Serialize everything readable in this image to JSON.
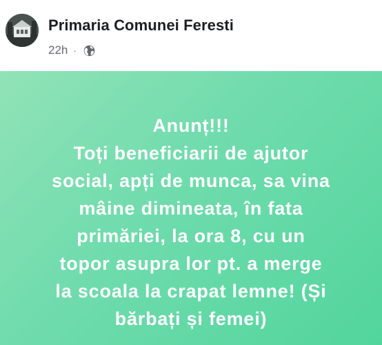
{
  "header": {
    "page_name": "Primaria Comunei Feresti",
    "time": "22h",
    "separator": "·",
    "audience_icon": "globe-icon"
  },
  "post": {
    "background_colors": [
      "#91e3b6",
      "#52d59d"
    ],
    "text_color": "#ffffff",
    "lines": [
      "Anunț!!!",
      "Toți beneficiarii de ajutor",
      "social, apți de munca, sa vina",
      "mâine dimineata, în fata",
      "primăriei, la ora 8, cu un",
      "topor asupra lor pt. a merge",
      "la scoala la crapat lemne! (Și",
      "bărbați și femei)"
    ]
  }
}
